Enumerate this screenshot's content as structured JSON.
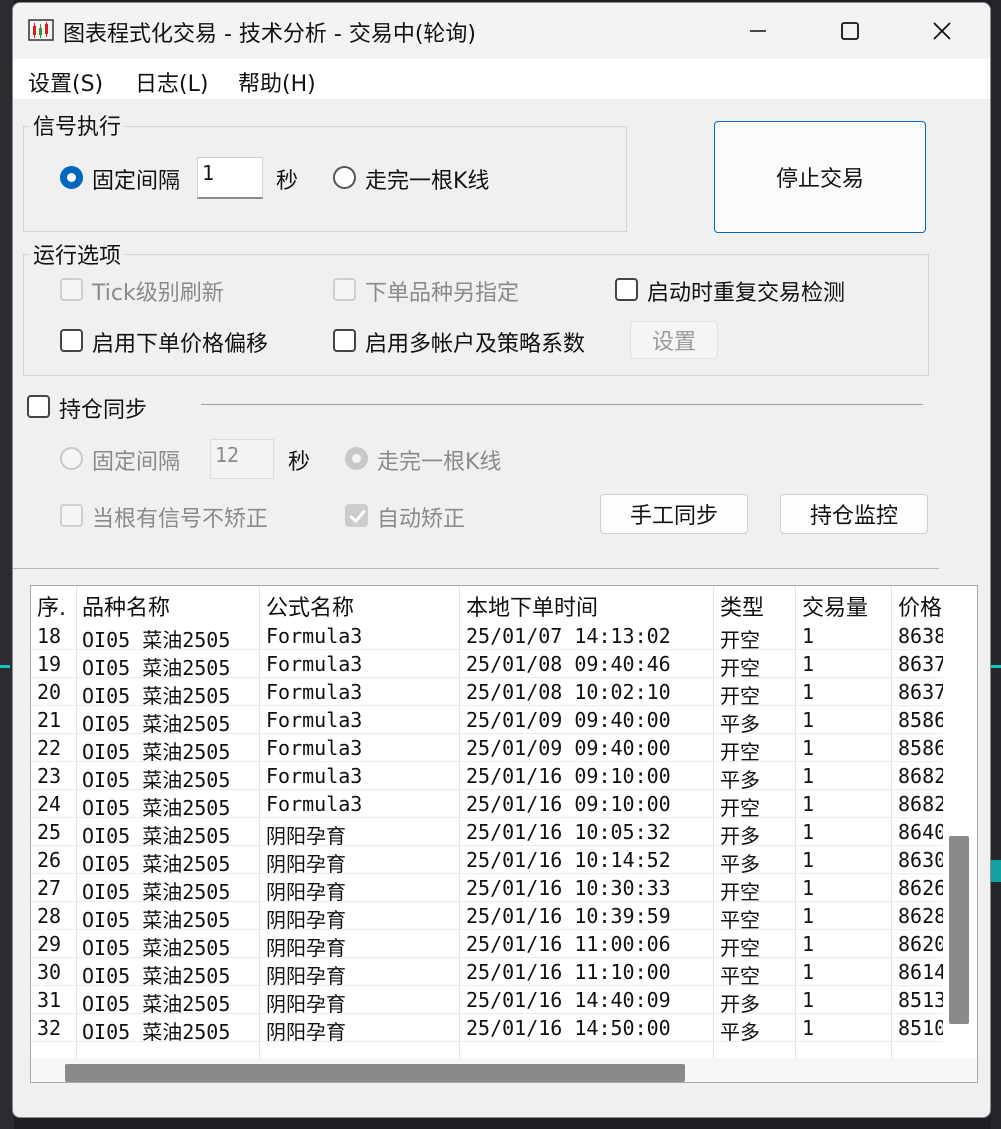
{
  "window": {
    "title": "图表程式化交易 - 技术分析 - 交易中(轮询)",
    "minimize_icon": "minimize-icon",
    "maximize_icon": "maximize-icon",
    "close_icon": "close-icon"
  },
  "menu": [
    "设置(S)",
    "日志(L)",
    "帮助(H)"
  ],
  "signal": {
    "title": "信号执行",
    "fixed_interval_label": "固定间隔",
    "interval_value": "1",
    "seconds_label": "秒",
    "kline_label": "走完一根K线",
    "selected": "fixed_interval"
  },
  "stop_button": "停止交易",
  "run_options": {
    "title": "运行选项",
    "tick_refresh": "Tick级别刷新",
    "order_symbol": "下单品种另指定",
    "startup_check": "启动时重复交易检测",
    "price_offset": "启用下单价格偏移",
    "multi_account": "启用多帐户及策略系数",
    "settings_button": "设置"
  },
  "position_sync": {
    "title": "持仓同步",
    "fixed_interval_label": "固定间隔",
    "interval_value": "12",
    "seconds_label": "秒",
    "kline_label": "走完一根K线",
    "no_correct_label": "当根有信号不矫正",
    "auto_correct_label": "自动矫正",
    "manual_sync_button": "手工同步",
    "monitor_button": "持仓监控"
  },
  "table": {
    "columns": [
      "序.",
      "品种名称",
      "公式名称",
      "本地下单时间",
      "类型",
      "交易量",
      "价格"
    ],
    "rows": [
      [
        "18",
        "OI05 菜油2505",
        "Formula3",
        "25/01/07 14:13:02",
        "开空",
        "1",
        "8638"
      ],
      [
        "19",
        "OI05 菜油2505",
        "Formula3",
        "25/01/08 09:40:46",
        "开空",
        "1",
        "8637"
      ],
      [
        "20",
        "OI05 菜油2505",
        "Formula3",
        "25/01/08 10:02:10",
        "开空",
        "1",
        "8637"
      ],
      [
        "21",
        "OI05 菜油2505",
        "Formula3",
        "25/01/09 09:40:00",
        "平多",
        "1",
        "8586"
      ],
      [
        "22",
        "OI05 菜油2505",
        "Formula3",
        "25/01/09 09:40:00",
        "开空",
        "1",
        "8586"
      ],
      [
        "23",
        "OI05 菜油2505",
        "Formula3",
        "25/01/16 09:10:00",
        "平多",
        "1",
        "8682"
      ],
      [
        "24",
        "OI05 菜油2505",
        "Formula3",
        "25/01/16 09:10:00",
        "开空",
        "1",
        "8682"
      ],
      [
        "25",
        "OI05 菜油2505",
        "阴阳孕育",
        "25/01/16 10:05:32",
        "开多",
        "1",
        "8640"
      ],
      [
        "26",
        "OI05 菜油2505",
        "阴阳孕育",
        "25/01/16 10:14:52",
        "平多",
        "1",
        "8630"
      ],
      [
        "27",
        "OI05 菜油2505",
        "阴阳孕育",
        "25/01/16 10:30:33",
        "开空",
        "1",
        "8626"
      ],
      [
        "28",
        "OI05 菜油2505",
        "阴阳孕育",
        "25/01/16 10:39:59",
        "平空",
        "1",
        "8628"
      ],
      [
        "29",
        "OI05 菜油2505",
        "阴阳孕育",
        "25/01/16 11:00:06",
        "开空",
        "1",
        "8620"
      ],
      [
        "30",
        "OI05 菜油2505",
        "阴阳孕育",
        "25/01/16 11:10:00",
        "平空",
        "1",
        "8614"
      ],
      [
        "31",
        "OI05 菜油2505",
        "阴阳孕育",
        "25/01/16 14:40:09",
        "开多",
        "1",
        "8513"
      ],
      [
        "32",
        "OI05 菜油2505",
        "阴阳孕育",
        "25/01/16 14:50:00",
        "平多",
        "1",
        "8510"
      ]
    ]
  },
  "colors": {
    "accent": "#0067c0",
    "window_bg": "#f0f0f0",
    "disabled_text": "#8a8a8a"
  }
}
